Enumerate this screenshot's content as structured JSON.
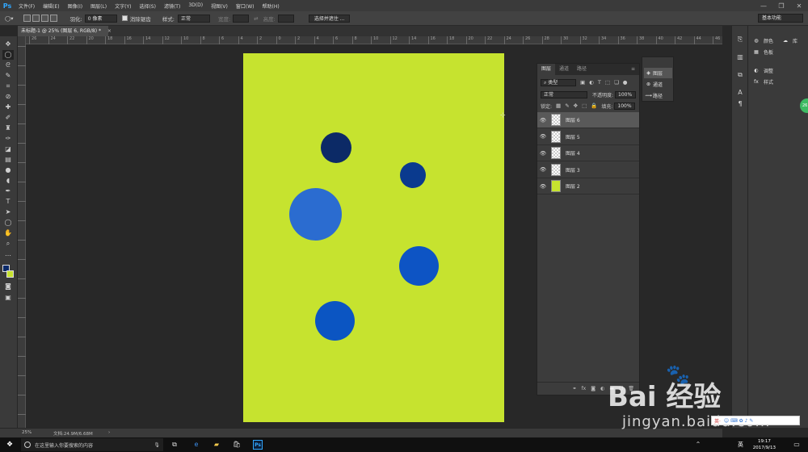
{
  "app": {
    "logo": "Ps",
    "brand_color": "#31a8ff"
  },
  "menu": [
    "文件(F)",
    "编辑(E)",
    "图像(I)",
    "图层(L)",
    "文字(Y)",
    "选择(S)",
    "滤镜(T)",
    "3D(D)",
    "视图(V)",
    "窗口(W)",
    "帮助(H)"
  ],
  "window_controls": {
    "minimize": "—",
    "restore": "❐",
    "close": "✕"
  },
  "options": {
    "feather_label": "羽化:",
    "feather_value": "0 像素",
    "antialias_label": "消除锯齿",
    "style_label": "样式:",
    "style_value": "正常",
    "width_label": "宽度:",
    "height_label": "高度:",
    "select_mask_button": "选择并遮住 ...",
    "workspace": "基本功能"
  },
  "document": {
    "tab_title": "未标题-1 @ 25% (图层 6, RGB/8) *",
    "tab_close": "×",
    "zoom": "25%",
    "doc_size": "文档:24.9M/6.68M",
    "canvas_color": "#c6e32f"
  },
  "ruler_labels": [
    "26",
    "24",
    "22",
    "20",
    "18",
    "16",
    "14",
    "12",
    "10",
    "8",
    "6",
    "4",
    "2",
    "0",
    "2",
    "4",
    "6",
    "8",
    "10",
    "12",
    "14",
    "16",
    "18",
    "20",
    "22",
    "24",
    "26",
    "28",
    "30",
    "32",
    "34",
    "36",
    "38",
    "40",
    "42",
    "44",
    "46"
  ],
  "circles": [
    {
      "name": "circle-dark-navy",
      "color": "#0c2a66"
    },
    {
      "name": "circle-navy",
      "color": "#0a3a8e"
    },
    {
      "name": "circle-light-blue",
      "color": "#2b6cd0"
    },
    {
      "name": "circle-blue-right",
      "color": "#0d54c4"
    },
    {
      "name": "circle-blue-bottom",
      "color": "#0b55c2"
    }
  ],
  "layers_panel": {
    "tabs": [
      "图层",
      "通道",
      "路径"
    ],
    "kind_filter": "类型",
    "blend_mode": "正常",
    "opacity_label": "不透明度:",
    "opacity_value": "100%",
    "lock_label": "锁定:",
    "fill_label": "填充:",
    "fill_value": "100%",
    "layers": [
      {
        "name": "图层 6",
        "selected": true
      },
      {
        "name": "图层 5",
        "selected": false
      },
      {
        "name": "图层 4",
        "selected": false
      },
      {
        "name": "图层 3",
        "selected": false
      },
      {
        "name": "图层 2",
        "selected": false
      }
    ],
    "bottom_icons": [
      "link-icon",
      "fx-icon",
      "mask-icon",
      "adjustment-icon",
      "folder-icon",
      "new-layer-icon",
      "trash-icon"
    ]
  },
  "mini_panel": [
    "图层",
    "通道",
    "路径"
  ],
  "right_dock": {
    "groups": [
      [
        "颜色",
        "色板"
      ],
      [
        "调整",
        "样式"
      ]
    ],
    "library": "库",
    "badge": "26"
  },
  "watermark": {
    "brand": "Bai  经验",
    "url": "jingyan.baidu.com"
  },
  "ime_bar": "英·",
  "taskbar": {
    "search_placeholder": "在这里输入你要搜索的内容",
    "lang": "英",
    "time": "19:17",
    "date": "2017/9/13"
  }
}
